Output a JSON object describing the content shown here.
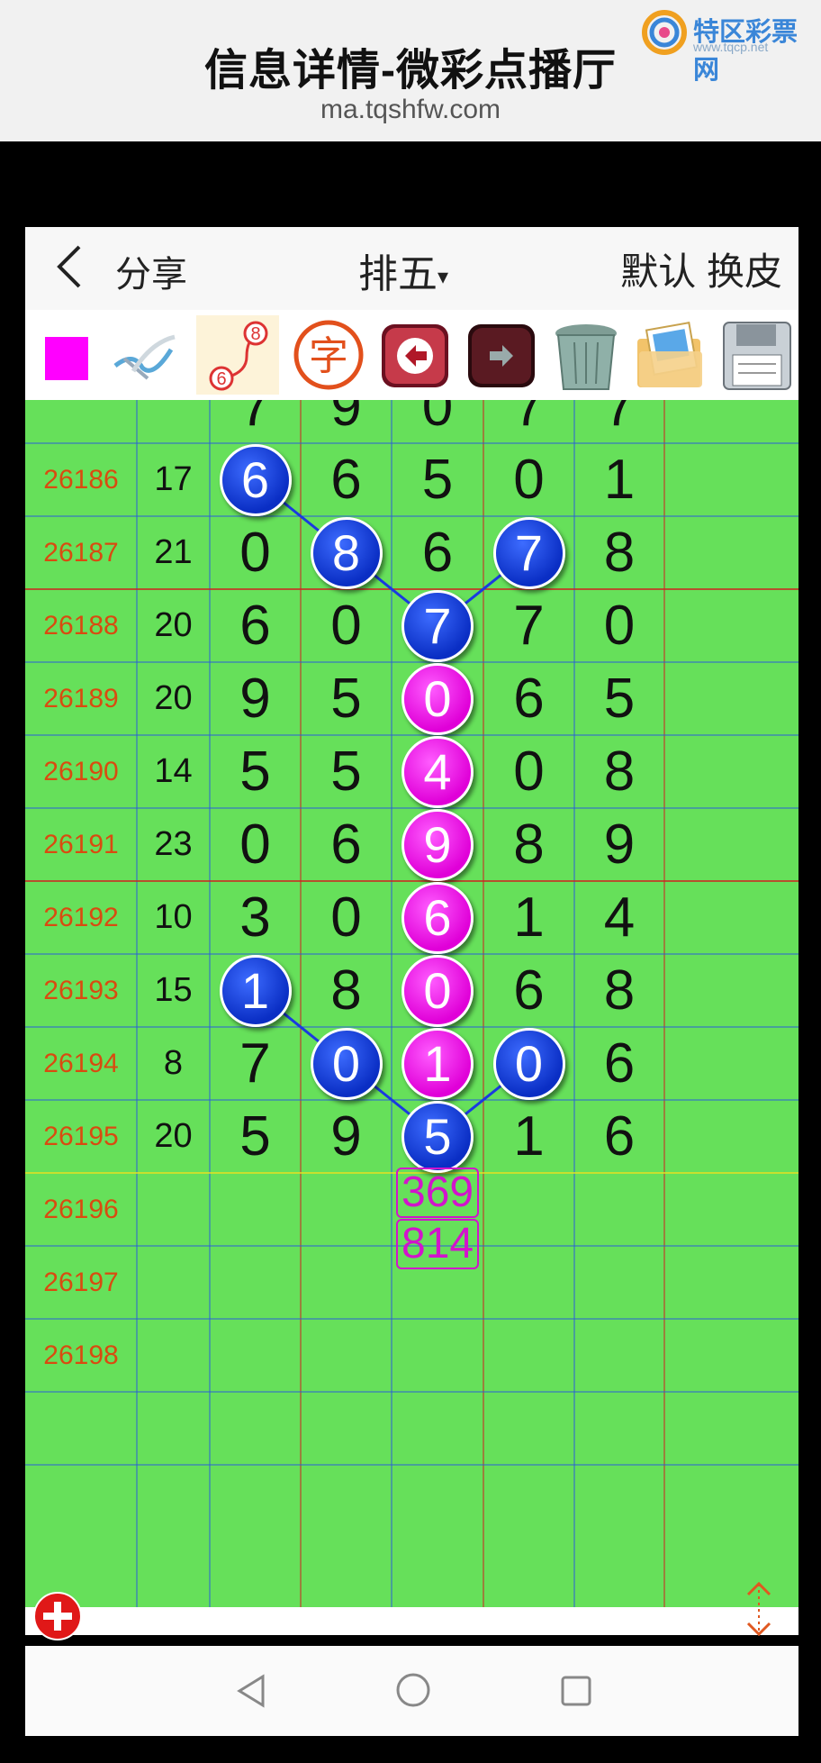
{
  "browser": {
    "title": "信息详情-微彩点播厅",
    "url": "ma.tqshfw.com",
    "brand_name": "特区彩票网",
    "brand_sub": "www.tqcp.net"
  },
  "appbar": {
    "back_icon": "chevron-left-icon",
    "share_label": "分享",
    "title": "排五",
    "title_caret": "▾",
    "default_label": "默认",
    "skin_label": "换皮"
  },
  "toolbar": {
    "icons": [
      "color-square-icon",
      "pen-icon",
      "link-numbers-icon",
      "text-icon",
      "undo-arrow-icon",
      "redo-arrow-icon",
      "trash-icon",
      "photos-icon",
      "save-disk-icon"
    ],
    "square_color": "#ff00ff",
    "link_icon_digits": [
      "8",
      "6"
    ],
    "text_icon_char": "字"
  },
  "colors": {
    "grid_bg": "#66e05a",
    "ball_blue": "#0a2ec4",
    "ball_pink": "#e000d8",
    "issue_text": "#d94b10"
  },
  "rows": [
    {
      "issue": "26186",
      "sum": "17",
      "digits": [
        "6",
        "6",
        "5",
        "0",
        "1"
      ]
    },
    {
      "issue": "26187",
      "sum": "21",
      "digits": [
        "0",
        "8",
        "6",
        "7",
        "8"
      ]
    },
    {
      "issue": "26188",
      "sum": "20",
      "digits": [
        "6",
        "0",
        "7",
        "7",
        "0"
      ]
    },
    {
      "issue": "26189",
      "sum": "20",
      "digits": [
        "9",
        "5",
        "0",
        "6",
        "5"
      ]
    },
    {
      "issue": "26190",
      "sum": "14",
      "digits": [
        "5",
        "5",
        "4",
        "0",
        "8"
      ]
    },
    {
      "issue": "26191",
      "sum": "23",
      "digits": [
        "0",
        "6",
        "9",
        "8",
        "9"
      ]
    },
    {
      "issue": "26192",
      "sum": "10",
      "digits": [
        "3",
        "0",
        "6",
        "1",
        "4"
      ]
    },
    {
      "issue": "26193",
      "sum": "15",
      "digits": [
        "1",
        "8",
        "0",
        "6",
        "8"
      ]
    },
    {
      "issue": "26194",
      "sum": "8",
      "digits": [
        "7",
        "0",
        "1",
        "0",
        "6"
      ]
    },
    {
      "issue": "26195",
      "sum": "20",
      "digits": [
        "5",
        "9",
        "5",
        "1",
        "6"
      ]
    },
    {
      "issue": "26196",
      "sum": "",
      "digits": [
        "",
        "",
        "",
        "",
        ""
      ]
    },
    {
      "issue": "26197",
      "sum": "",
      "digits": [
        "",
        "",
        "",
        "",
        ""
      ]
    },
    {
      "issue": "26198",
      "sum": "",
      "digits": [
        "",
        "",
        "",
        "",
        ""
      ]
    }
  ],
  "highlights": [
    {
      "row": 0,
      "col": 0,
      "color": "blue"
    },
    {
      "row": 1,
      "col": 1,
      "color": "blue"
    },
    {
      "row": 2,
      "col": 2,
      "color": "blue"
    },
    {
      "row": 1,
      "col": 3,
      "color": "blue"
    },
    {
      "row": 3,
      "col": 2,
      "color": "pink"
    },
    {
      "row": 4,
      "col": 2,
      "color": "pink"
    },
    {
      "row": 5,
      "col": 2,
      "color": "pink"
    },
    {
      "row": 6,
      "col": 2,
      "color": "pink"
    },
    {
      "row": 7,
      "col": 0,
      "color": "blue"
    },
    {
      "row": 7,
      "col": 2,
      "color": "pink"
    },
    {
      "row": 8,
      "col": 1,
      "color": "blue"
    },
    {
      "row": 8,
      "col": 2,
      "color": "pink"
    },
    {
      "row": 9,
      "col": 2,
      "color": "blue"
    },
    {
      "row": 8,
      "col": 3,
      "color": "blue"
    }
  ],
  "connector_lines": [
    [
      {
        "row": 0,
        "col": 0
      },
      {
        "row": 1,
        "col": 1
      },
      {
        "row": 2,
        "col": 2
      },
      {
        "row": 1,
        "col": 3
      }
    ],
    [
      {
        "row": 7,
        "col": 0
      },
      {
        "row": 8,
        "col": 1
      },
      {
        "row": 9,
        "col": 2
      },
      {
        "row": 8,
        "col": 3
      }
    ]
  ],
  "predictions": [
    "369",
    "814"
  ],
  "footer": {
    "add_icon": "plus-circle-icon",
    "expand_icon": "expand-vertical-icon"
  },
  "navbar": {
    "back": "nav-back-icon",
    "home": "nav-home-icon",
    "recent": "nav-recent-icon"
  }
}
